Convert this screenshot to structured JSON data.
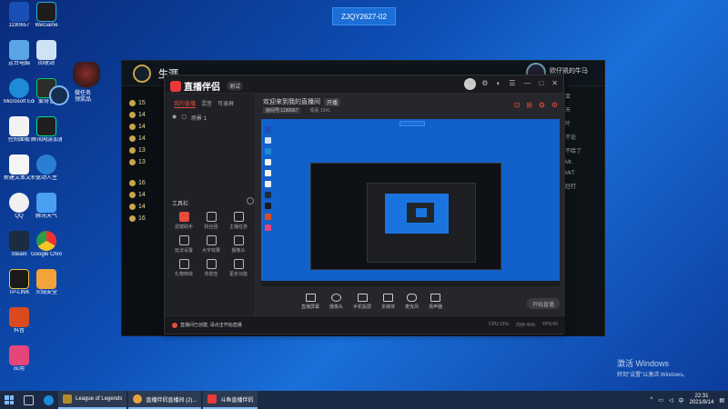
{
  "top_badge": "ZJQY2627-02",
  "desktop": {
    "icons": [
      {
        "label": "1190657",
        "color": "#1a4fb5"
      },
      {
        "label": "这台电脑",
        "color": "#5ba4e6"
      },
      {
        "label": "WeGame",
        "color": "#1d1d1d"
      },
      {
        "label": "回收站",
        "color": "#cfe3f5"
      },
      {
        "label": "Microsoft Edge",
        "color": "#1d8bd8"
      },
      {
        "label": "爱奇艺",
        "color": "#2c2c2c"
      },
      {
        "label": "控制面板",
        "color": "#f2f2f2"
      },
      {
        "label": "腾讯网游加速器",
        "color": "#1f1f1f"
      },
      {
        "label": "新建文本文档",
        "color": "#f5f5f5"
      },
      {
        "label": "驱动人生",
        "color": "#2a7fd4"
      },
      {
        "label": "QQ",
        "color": "#f0f0f0"
      },
      {
        "label": "腾讯天气",
        "color": "#49a0f0"
      },
      {
        "label": "Steam",
        "color": "#1c2b3f"
      },
      {
        "label": "Google Chrome",
        "color": "#f3c623"
      },
      {
        "label": "TP-LINK",
        "color": "#1a1a1a"
      },
      {
        "label": "火绒安全",
        "color": "#f2a33a"
      },
      {
        "label": "抖音",
        "color": "#d94b1e"
      },
      {
        "label": "应用",
        "color": "#e6457c"
      }
    ],
    "widget_text": [
      "做任务",
      "领奖品"
    ]
  },
  "lol_window": {
    "title": "生涯",
    "left_list": [
      "15",
      "14",
      "14",
      "14",
      "13",
      "13",
      "16",
      "14",
      "14",
      "16"
    ],
    "profile_name": "欧仔凯的牛马",
    "right_lines": [
      "亚",
      "天",
      "叶",
      "不论",
      "不给了",
      "Mr.",
      "MrT",
      "赶打"
    ]
  },
  "zb": {
    "logo_name": "直播伴侣",
    "version": "测试",
    "tabs": [
      "我的直播",
      "混音",
      "可录屏"
    ],
    "scene_label": "场景 1",
    "tools_title": "工具栏",
    "tools": [
      "滤镜助手",
      "粉丝团",
      "主播任务",
      "玩法设置",
      "大字效果",
      "摄像头",
      "礼物特效",
      "背景音",
      "更多功能"
    ],
    "room_title": "欢迎来到我的直播间",
    "room_tag": "开播",
    "info": [
      "房间号:1190657",
      "观看 1341"
    ],
    "actions": [
      "直播屏幕",
      "摄像头",
      "手机投屏",
      "多媒体",
      "麦克风",
      "扬声器"
    ],
    "start_button": "开始直播",
    "status_msg": "直播间已创建, 请点击开始直播",
    "status_stats": [
      "CPU:12%",
      "内存:45%",
      "FPS:60"
    ]
  },
  "activate": {
    "line1": "激活 Windows",
    "line2": "转到\"设置\"以激活 Windows。"
  },
  "taskbar": {
    "apps": [
      {
        "label": "League of Legends",
        "color": "#b48a2c"
      },
      {
        "label": "直播伴侣直播间 (2)...",
        "color": "#e9a23b"
      },
      {
        "label": "斗鱼直播伴侣",
        "color": "#e73a3a"
      }
    ],
    "time": "22:31",
    "date": "2021/8/14"
  }
}
